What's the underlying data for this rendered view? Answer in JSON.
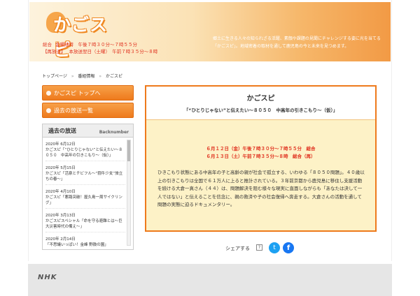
{
  "header": {
    "logo_text": "かごスピ",
    "schedule_line1_channel": "総合",
    "schedule_line1_time": "金曜随時　午後７時３０分～７時５５分",
    "schedule_line2_tag": "【再放送】",
    "schedule_line2_time": "本放送翌日（土曜）　午前７時３５分～８時",
    "description": "郷土に生きる人々の知られざる活躍、素顔や課題の見聞にチャレンジする姿に光を当てる「かごスピ」。地域密着の取材を通して鹿児島の今と未来を見つめます。"
  },
  "breadcrumb": {
    "items": [
      "トップページ",
      "番組情報",
      "かごスピ"
    ],
    "separator": "»"
  },
  "sidebar": {
    "top_button": "かごスピ トップへ",
    "past_button": "過去の放送一覧",
    "past_panel": {
      "title": "過去の放送",
      "subtitle": "Backnumber",
      "items": [
        {
          "date": "2020年 6月12日",
          "title": "かごスピ「“ひとりじゃない”と伝えたい～８０５０　中高年の引きこもり～（仮）」"
        },
        {
          "date": "2020年 5月15日",
          "title": "かごスピ「活泉とチビフル～“闘牛少女”旅立ちの春～」"
        },
        {
          "date": "2020年 4月10日",
          "title": "かごスピ「悪路突破！屋久島一周サイクリング」"
        },
        {
          "date": "2020年 3月13日",
          "title": "かごスピスペシャル「命を守る避難とは～巨大災害時代の備え～」"
        },
        {
          "date": "2020年 2月14日",
          "title": "「不思議いっぱい！金峰 野鼓の園」"
        }
      ]
    }
  },
  "main": {
    "title": "かごスピ",
    "subtitle": "「“ひとりじゃない”と伝えたい～８０５０　中高年の引きこもり～（仮）」",
    "airtime1": "６月１２日（金）午後７時３０分～７時５５分　総合",
    "airtime2": "６月１３日（土）午前７時３５分～８時　総合（再）",
    "description": "ひきこもり状態にある中高年の子と高齢の親が社会で孤立する、いわゆる「８０５０問題」。４０歳以上の引きこもりは全国で６１万人に上ると推計されている。３年前京都から鹿児島に移住し支援活動を続ける大倉一真さん（４４）は、問題解決を阻む様々な現実に直面しながらも「あなたは決して一人ではない」と伝えることを信念に、親の救済や子の社会復帰へ奔走する。大倉さんの活動を通して問題の実態に迫るドキュメンタリー。"
  },
  "share": {
    "label": "シェアする",
    "help": "?",
    "twitter_glyph": "t",
    "facebook_glyph": "f"
  },
  "footer": {
    "logo": "NHK"
  }
}
